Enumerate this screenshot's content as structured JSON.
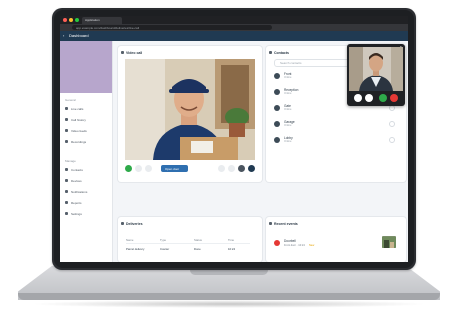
{
  "browser": {
    "tab_title": "Application",
    "url": "app.example.com/dashboard/deliveries/live-call"
  },
  "app": {
    "title": "Dashboard",
    "back_glyph": "‹"
  },
  "sidebar": {
    "section_one_label": "General",
    "items_one": [
      "Live calls",
      "Call history",
      "Video feeds",
      "Recordings"
    ],
    "section_two_label": "Manage",
    "items_two": [
      "Contacts",
      "Devices",
      "Notifications",
      "Reports",
      "Settings"
    ]
  },
  "video_card": {
    "title": "Video call",
    "action_label": "Open door"
  },
  "contacts_card": {
    "title": "Contacts",
    "search_placeholder": "Search contacts",
    "contacts": [
      {
        "name": "Front",
        "sub": "Online"
      },
      {
        "name": "Reception",
        "sub": "Online"
      },
      {
        "name": "Gate",
        "sub": "Online"
      },
      {
        "name": "Garage",
        "sub": "Online"
      },
      {
        "name": "Lobby",
        "sub": "Online"
      }
    ]
  },
  "table_card": {
    "title": "Deliveries",
    "headers": [
      "Name",
      "Type",
      "Status",
      "Time"
    ],
    "row": [
      "Parcel delivery",
      "Courier",
      "Done",
      "10:24"
    ]
  },
  "events_card": {
    "title": "Recent events",
    "event_name": "Doorbell",
    "event_sub": "Front door · 10:24",
    "event_badge": "New"
  },
  "colors": {
    "app_header": "#203a52",
    "accent": "#2f6fb0",
    "call_accept": "#2eaa4a",
    "call_end": "#e53935",
    "sidebar_hero": "#b7a6cc"
  }
}
